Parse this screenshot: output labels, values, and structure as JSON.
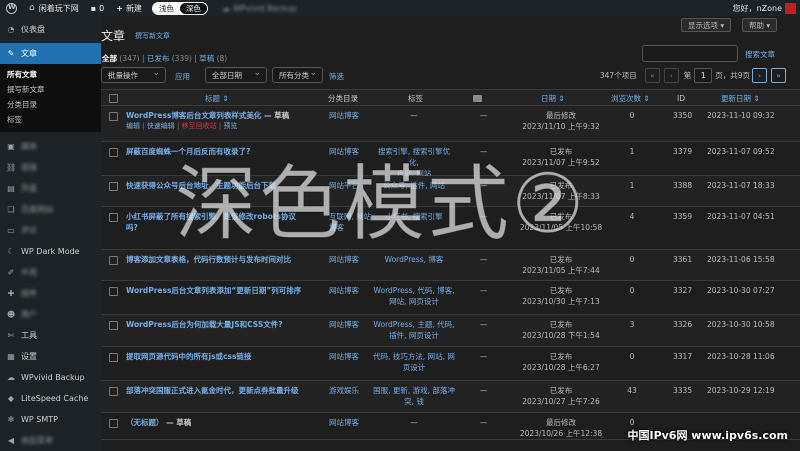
{
  "adminbar": {
    "site_name": "闲着玩下网",
    "comments": "0",
    "new_label": "新建",
    "mode_light": "浅色",
    "mode_dark": "深色",
    "plugin": "WPvivid Backup",
    "greeting": "您好，",
    "user": "nZone"
  },
  "sidebar": {
    "dashboard": "仪表盘",
    "posts": "文章",
    "submenu": [
      "所有文章",
      "撰写新文章",
      "分类目录",
      "标签"
    ],
    "items": [
      "媒体",
      "链接",
      "页面",
      "百度网站",
      "评论",
      "WP Dark Mode",
      "外观",
      "插件",
      "用户",
      "工具",
      "设置",
      "WPvivid Backup",
      "LiteSpeed Cache",
      "WP SMTP",
      "收起菜单"
    ]
  },
  "header": {
    "screen_options": "显示选项 ▾",
    "help": "帮助 ▾",
    "title": "文章",
    "add_new": "撰写新文章",
    "search_button": "搜索文章"
  },
  "filters": {
    "all": "全部",
    "all_count": "(347)",
    "published": "已发布",
    "published_count": "(339)",
    "drafts": "草稿",
    "drafts_count": "(8)"
  },
  "tablenav": {
    "bulk_action": "批量操作",
    "apply": "应用",
    "all_dates": "全部日期",
    "all_categories": "所有分类",
    "filter": "筛选",
    "items_count": "347个项目",
    "first": "«",
    "prev": "‹",
    "page_prefix": "第",
    "current_page": "1",
    "page_suffix": "页，共9页",
    "next": "›",
    "last": "»"
  },
  "columns": {
    "title": "标题 ⇕",
    "category": "分类目录",
    "tags": "标签",
    "date": "日期 ⇕",
    "views": "浏览次数 ⇕",
    "id": "ID",
    "modified": "更新日期 ⇕"
  },
  "posts": [
    {
      "title": "WordPress博客后台文章列表样式美化",
      "state": " — 草稿",
      "actions": [
        "编辑",
        "快速编辑",
        "移至回收站",
        "预览"
      ],
      "category": "网站博客",
      "tags": [
        "—"
      ],
      "comments": "—",
      "date_status": "最后修改",
      "date": "2023/11/10 上午9:32",
      "views": "0",
      "id": "3350",
      "modified": "2023-11-10 09:32"
    },
    {
      "title": "屏蔽百度蜘蛛一个月后反而有收录了?",
      "state": "",
      "actions": [],
      "category": "网站博客",
      "tags": [
        "搜索引擎, 搜索引擎优化,",
        "百度, 网站"
      ],
      "comments": "—",
      "date_status": "已发布",
      "date": "2023/11/07 上午9:52",
      "views": "1",
      "id": "3379",
      "modified": "2023-11-07 09:52"
    },
    {
      "title": "快速获得公众号后台地址、主题功能后台下载",
      "state": "",
      "actions": [],
      "category": "网站平台",
      "tags": [
        "公众号, 插件, 网站"
      ],
      "comments": "—",
      "date_status": "已发布",
      "date": "2023/11/07 上午8:33",
      "views": "1",
      "id": "3388",
      "modified": "2023-11-07 18:33"
    },
    {
      "title": "小红书屏蔽了所有搜索引擎，是该修改robots协议",
      "title2": "吗?",
      "state": "",
      "actions": [],
      "category": "互联网, 网站",
      "category2": "博客",
      "tags": [
        "小红书, 搜索引擎"
      ],
      "comments": "—",
      "date_status": "已发布",
      "date": "2023/11/05 上午10:58",
      "views": "4",
      "id": "3359",
      "modified": "2023-11-07 04:51"
    },
    {
      "title": "博客添加文章表格，代码行数预计与发布时间对比",
      "state": "",
      "actions": [],
      "category": "网站博客",
      "tags": [
        "WordPress, 博客"
      ],
      "comments": "—",
      "date_status": "已发布",
      "date": "2023/11/05 上午7:44",
      "views": "0",
      "id": "3361",
      "modified": "2023-11-06 15:58"
    },
    {
      "title": "WordPress后台文章列表添加“更新日期”列可排序",
      "state": "",
      "actions": [],
      "category": "网站博客",
      "tags": [
        "WordPress, 代码, 博客,",
        "网站, 网页设计"
      ],
      "comments": "—",
      "date_status": "已发布",
      "date": "2023/10/30 上午7:13",
      "views": "0",
      "id": "3327",
      "modified": "2023-10-30 07:27"
    },
    {
      "title": "WordPress后台为何加载大量JS和CSS文件?",
      "state": "",
      "actions": [],
      "category": "网站博客",
      "tags": [
        "WordPress, 主题, 代码,",
        "插件, 网页设计"
      ],
      "comments": "—",
      "date_status": "已发布",
      "date": "2023/10/28 下午1:54",
      "views": "3",
      "id": "3326",
      "modified": "2023-10-30 10:58"
    },
    {
      "title": "提取网页源代码中的所有js或css链接",
      "state": "",
      "actions": [],
      "category": "网站博客",
      "tags": [
        "代码, 技巧方法, 网站, 网",
        "页设计"
      ],
      "comments": "—",
      "date_status": "已发布",
      "date": "2023/10/28 上午6:27",
      "views": "0",
      "id": "3317",
      "modified": "2023-10-28 11:06"
    },
    {
      "title": "部落冲突国服正式进入氪金时代，更新点券批量升级",
      "state": "",
      "actions": [],
      "category": "游戏娱乐",
      "tags": [
        "国服, 更新, 游戏, 部落冲",
        "突, 钱"
      ],
      "comments": "—",
      "date_status": "已发布",
      "date": "2023/10/27 上午7:26",
      "views": "43",
      "id": "3335",
      "modified": "2023-10-29 12:19"
    },
    {
      "title": "（无标题）",
      "state": " — 草稿",
      "actions": [],
      "category": "网站博客",
      "tags": [
        "—"
      ],
      "comments": "—",
      "date_status": "最后修改",
      "date": "2023/10/26 上午12:38",
      "views": "0",
      "id": "",
      "modified": ""
    }
  ],
  "overlay_text": "深色模式②",
  "watermark": "中国IPv6网 www.ipv6s.com"
}
